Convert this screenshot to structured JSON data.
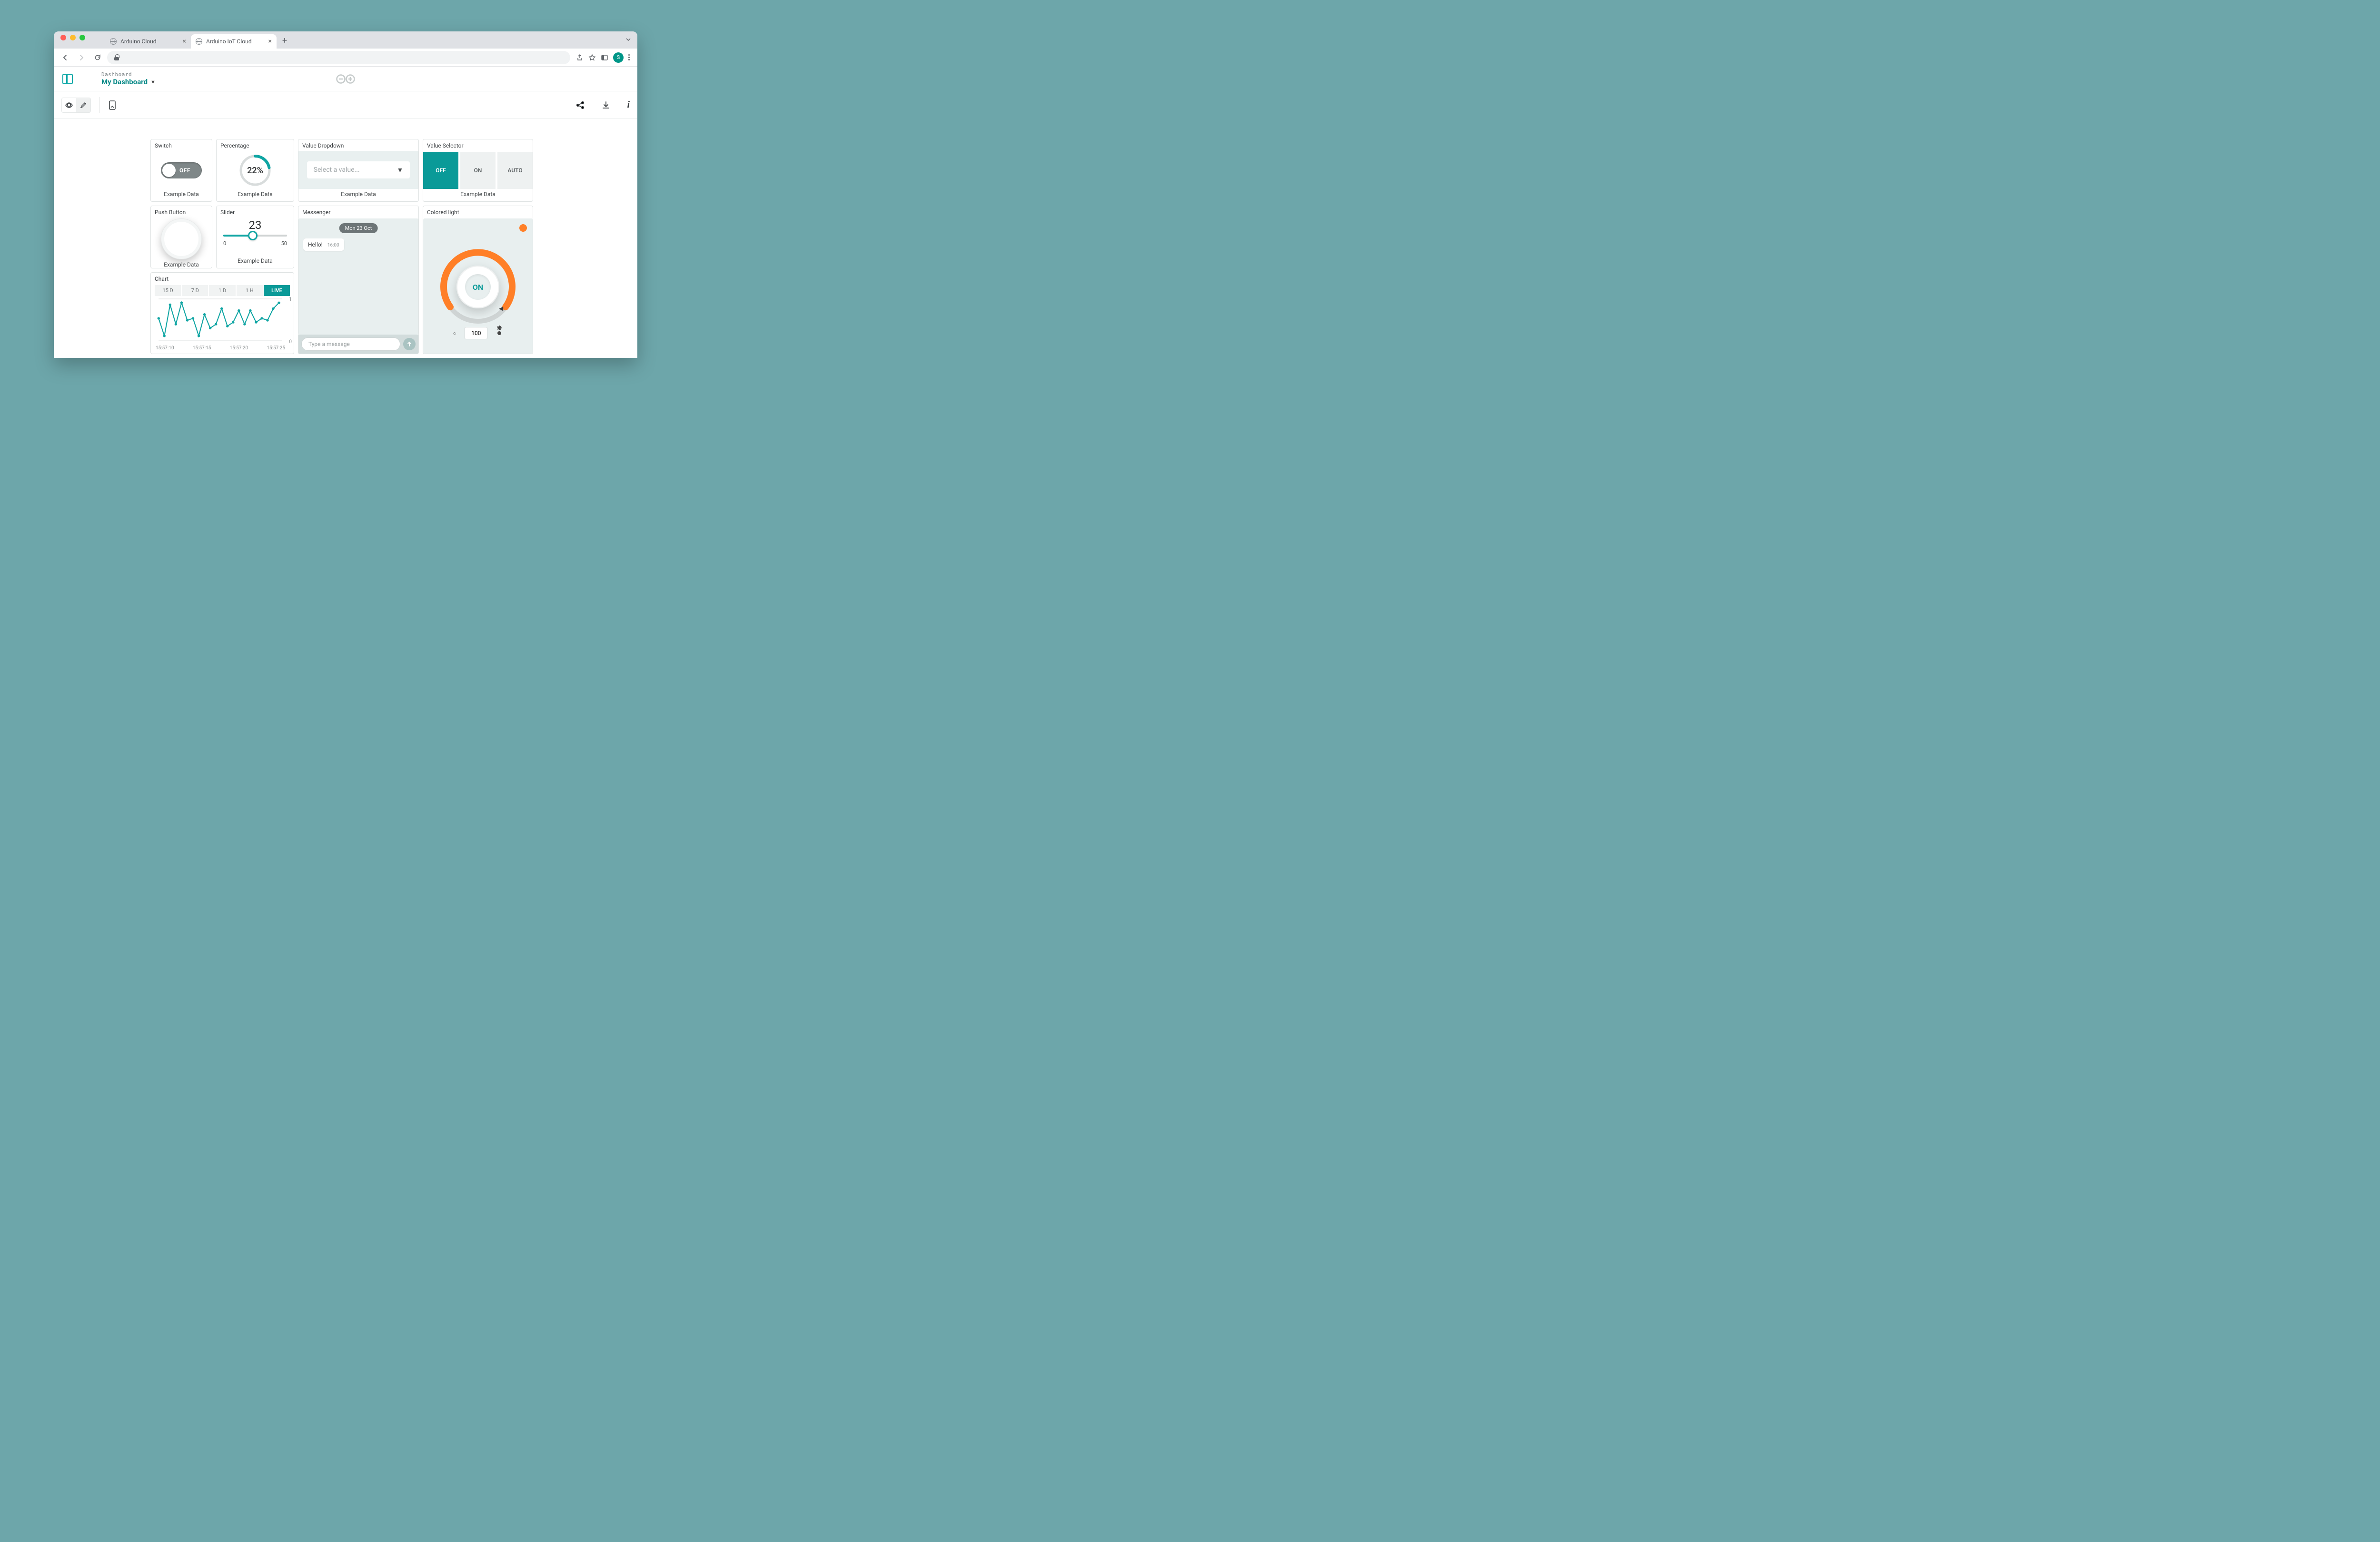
{
  "browser": {
    "tabs": [
      {
        "title": "Arduino Cloud",
        "active": false
      },
      {
        "title": "Arduino IoT Cloud",
        "active": true
      }
    ],
    "avatar_initial": "S"
  },
  "header": {
    "crumb": "Dashboard",
    "title": "My Dashboard"
  },
  "widgets": {
    "switch": {
      "title": "Switch",
      "value_label": "OFF",
      "footer": "Example Data"
    },
    "percent": {
      "title": "Percentage",
      "value": 22,
      "display": "22%",
      "footer": "Example Data"
    },
    "dropdown": {
      "title": "Value Dropdown",
      "placeholder": "Select a value...",
      "footer": "Example Data"
    },
    "selector": {
      "title": "Value Selector",
      "options": [
        "OFF",
        "ON",
        "AUTO"
      ],
      "selected": "OFF",
      "footer": "Example Data"
    },
    "push": {
      "title": "Push Button",
      "footer": "Example Data"
    },
    "slider": {
      "title": "Slider",
      "value": 23,
      "min": 0,
      "max": 50,
      "footer": "Example Data"
    },
    "messenger": {
      "title": "Messenger",
      "date_badge": "Mon 23 Oct",
      "messages": [
        {
          "text": "Hello!",
          "time": "16:00"
        }
      ],
      "compose_placeholder": "Type a message"
    },
    "light": {
      "title": "Colored light",
      "state_label": "ON",
      "brightness": 100,
      "color": "#ff7f27"
    },
    "chart": {
      "title": "Chart",
      "ranges": [
        "15 D",
        "7 D",
        "1 D",
        "1 H",
        "LIVE"
      ],
      "active_range": "LIVE"
    }
  },
  "chart_data": {
    "type": "line",
    "title": "",
    "xlabel": "",
    "ylabel": "",
    "ylim": [
      0,
      1
    ],
    "yticks": [
      0,
      1
    ],
    "x_tick_labels": [
      "15:57:10",
      "15:57:15",
      "15:57:20",
      "15:57:25"
    ],
    "series": [
      {
        "name": "Example Data",
        "color": "#0fa5a3",
        "values": [
          0.55,
          0.1,
          0.9,
          0.4,
          0.95,
          0.5,
          0.55,
          0.1,
          0.65,
          0.3,
          0.4,
          0.8,
          0.35,
          0.45,
          0.75,
          0.4,
          0.75,
          0.45,
          0.55,
          0.5,
          0.8,
          0.95
        ]
      }
    ]
  }
}
